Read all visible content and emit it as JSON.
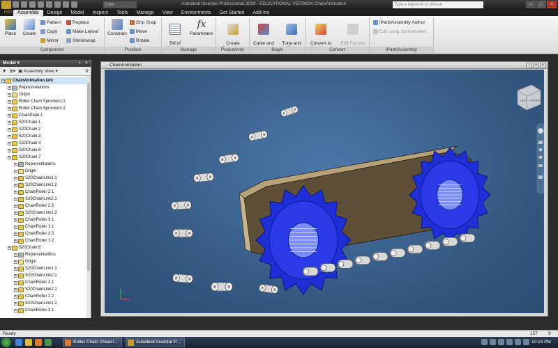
{
  "titlebar": {
    "color_select": "Color",
    "window_title": "Autodesk Inventor Professional 2010 - EDUCATIONAL VERSION    ChainAnimation",
    "search_placeholder": "Type a keyword or phrase"
  },
  "ribbon_tabs": [
    "Assemble",
    "Design",
    "Model",
    "Inspect",
    "Tools",
    "Manage",
    "View",
    "Environments",
    "Get Started",
    "Add-Ins"
  ],
  "pro_tag": "PRO",
  "ribbon": {
    "component": {
      "label": "Component",
      "place": "Place",
      "create": "Create",
      "pattern": "Pattern",
      "copy": "Copy",
      "mirror": "Mirror",
      "replace": "Replace",
      "make_layout": "Make Layout",
      "shrinkwrap": "Shrinkwrap"
    },
    "position": {
      "label": "Position",
      "constrain": "Constrain",
      "grip_snap": "Grip Snap",
      "move": "Move",
      "rotate": "Rotate"
    },
    "manage": {
      "label": "Manage",
      "bill_of_materials": "Bill of\nMaterials",
      "parameters": "Parameters"
    },
    "productivity": {
      "label": "Productivity",
      "create_substitutes": "Create\nSubstitutes"
    },
    "begin": {
      "label": "Begin",
      "cable_and_harness": "Cable and\nHarness",
      "tube_and_pipe": "Tube and\nPipe"
    },
    "convert": {
      "label": "Convert",
      "convert_to_weldment": "Convert to\nWeldment",
      "edit_factory_scope": "Edit Factory\nScope"
    },
    "ipart": {
      "label": "iPart/iAssembly",
      "author": "iPart/iAssembly Author",
      "edit_spreadsheet": "Edit using Spreadsheet"
    }
  },
  "browser": {
    "title": "Model",
    "view_selector": "Assembly View",
    "tree": [
      {
        "label": "ChainAnimation.iam",
        "level": 0,
        "type": "asm",
        "bold": true
      },
      {
        "label": "Representations",
        "level": 1,
        "type": "rep"
      },
      {
        "label": "Origin",
        "level": 1,
        "type": "folder"
      },
      {
        "label": "Roller Chain Sprocket1:1",
        "level": 1,
        "type": "part"
      },
      {
        "label": "Roller Chain Sprocket1:2",
        "level": 1,
        "type": "part"
      },
      {
        "label": "ChainPlate:1",
        "level": 1,
        "type": "part"
      },
      {
        "label": "S20Chain:1",
        "level": 1,
        "type": "asm"
      },
      {
        "label": "S20Chain:2",
        "level": 1,
        "type": "asm"
      },
      {
        "label": "S20Chain:3",
        "level": 1,
        "type": "asm"
      },
      {
        "label": "S20Chain:4",
        "level": 1,
        "type": "asm"
      },
      {
        "label": "S20Chain:6",
        "level": 1,
        "type": "asm"
      },
      {
        "label": "S20Chain:7",
        "level": 1,
        "type": "asm"
      },
      {
        "label": "Representations",
        "level": 2,
        "type": "rep"
      },
      {
        "label": "Origin",
        "level": 2,
        "type": "folder"
      },
      {
        "label": "S20ChainLink1:1",
        "level": 2,
        "type": "part"
      },
      {
        "label": "S20ChainLink1:2",
        "level": 2,
        "type": "part"
      },
      {
        "label": "ChainRoller 2:1",
        "level": 2,
        "type": "part"
      },
      {
        "label": "S20ChainLink2:1",
        "level": 2,
        "type": "part"
      },
      {
        "label": "ChainRoller 2:2",
        "level": 2,
        "type": "part"
      },
      {
        "label": "S20ChainLink1:2",
        "level": 2,
        "type": "part"
      },
      {
        "label": "ChainRoller 3:1",
        "level": 2,
        "type": "part"
      },
      {
        "label": "ChainRoller 1:1",
        "level": 2,
        "type": "part"
      },
      {
        "label": "ChainRoller 3:2",
        "level": 2,
        "type": "part"
      },
      {
        "label": "ChainRoller 1:2",
        "level": 2,
        "type": "part"
      },
      {
        "label": "S20Chain:8",
        "level": 1,
        "type": "asm"
      },
      {
        "label": "Representations",
        "level": 2,
        "type": "rep"
      },
      {
        "label": "Origin",
        "level": 2,
        "type": "folder"
      },
      {
        "label": "S20ChainLink1:1",
        "level": 2,
        "type": "part"
      },
      {
        "label": "S20ChainLink2:1",
        "level": 2,
        "type": "part"
      },
      {
        "label": "ChainRoller 2:1",
        "level": 2,
        "type": "part"
      },
      {
        "label": "S20ChainLink2:2",
        "level": 2,
        "type": "part"
      },
      {
        "label": "ChainRoller 2:2",
        "level": 2,
        "type": "part"
      },
      {
        "label": "S20ChainLink1:2",
        "level": 2,
        "type": "part"
      },
      {
        "label": "ChainRoller 3:1",
        "level": 2,
        "type": "part"
      }
    ]
  },
  "document": {
    "title": "ChainAnimation",
    "viewcube_left": "LEFT",
    "viewcube_front": "FRONT"
  },
  "colors": {
    "sprocket": "#1f2fd8",
    "plate": "#5e4f38",
    "chain": "#d9d9d9",
    "viewport": "#3a628f"
  },
  "statusbar": {
    "ready": "Ready",
    "count_1": "157",
    "count_2": "9"
  },
  "taskbar": {
    "task_1": "Roller Chain Chaos!...",
    "task_2": "Autodesk Inventor P...",
    "clock": "10:18 PM"
  }
}
